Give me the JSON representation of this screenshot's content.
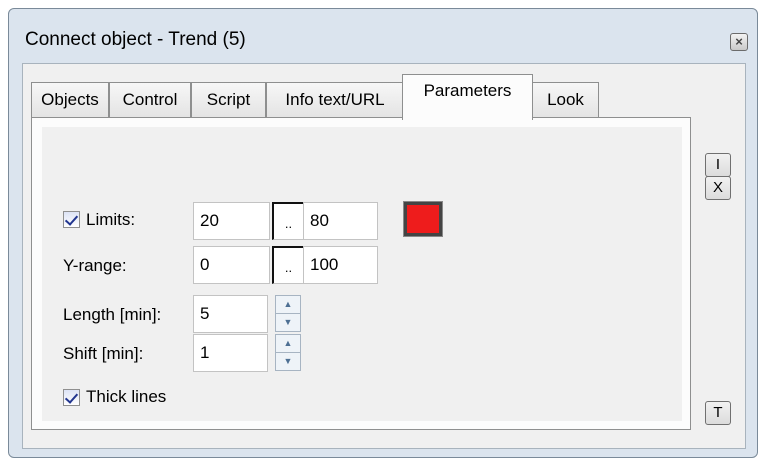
{
  "window": {
    "title": "Connect object - Trend (5)",
    "close_icon": "close-icon"
  },
  "tabs": [
    {
      "label": "Objects"
    },
    {
      "label": "Control"
    },
    {
      "label": "Script"
    },
    {
      "label": "Info text/URL"
    },
    {
      "label": "Parameters",
      "active": true
    },
    {
      "label": "Look"
    }
  ],
  "side_buttons": {
    "ok": "I",
    "cancel": "X",
    "text": "T"
  },
  "params": {
    "limits": {
      "label": "Limits:",
      "checked": true,
      "min": "20",
      "max": "80",
      "range_button": "..",
      "color": "#ee1c1c"
    },
    "yrange": {
      "label": "Y-range:",
      "min": "0",
      "max": "100",
      "range_button": ".."
    },
    "length": {
      "label": "Length [min]:",
      "value": "5"
    },
    "shift": {
      "label": "Shift  [min]:",
      "value": "1"
    },
    "thick_lines": {
      "label": "Thick lines",
      "checked": true
    }
  }
}
